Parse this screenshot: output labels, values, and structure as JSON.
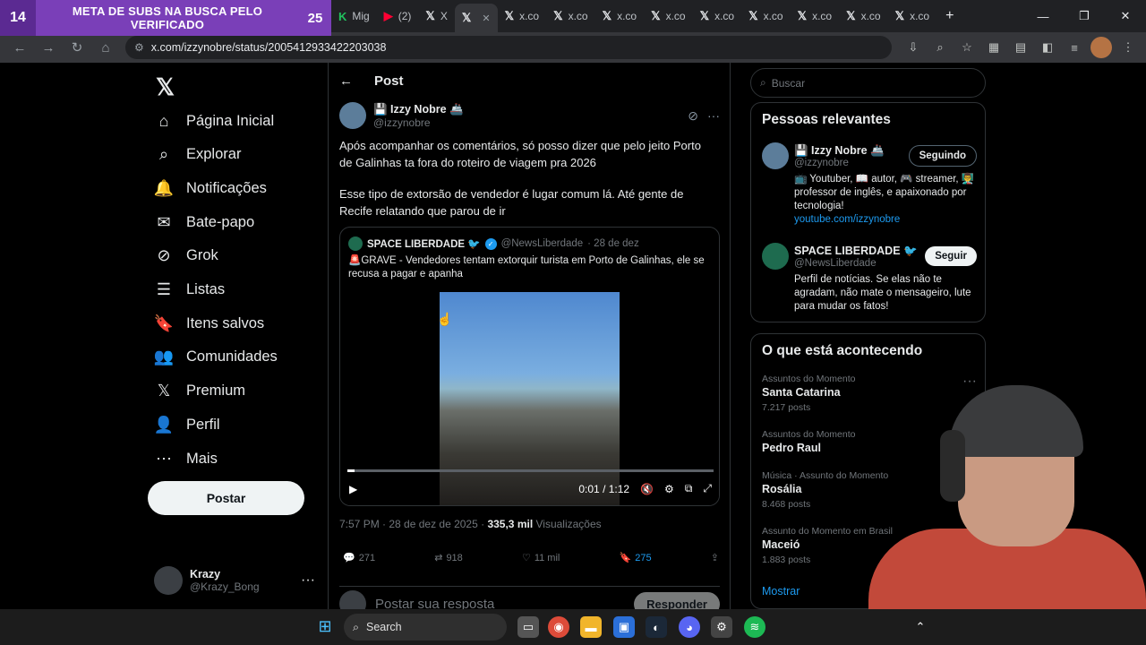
{
  "overlay": {
    "left_num": "14",
    "text": "META DE SUBS NA BUSCA PELO VERIFICADO",
    "right_num": "25"
  },
  "tabs": [
    {
      "icon": "K",
      "label": "Mig",
      "color": "#21c25e"
    },
    {
      "icon": "▶",
      "label": "(2)",
      "color": "#ff0033"
    },
    {
      "icon": "𝕏",
      "label": "X",
      "color": "#e8eaed"
    },
    {
      "icon": "𝕏",
      "label": "",
      "color": "#e8eaed",
      "active": true
    },
    {
      "icon": "𝕏",
      "label": "x.co",
      "color": "#e8eaed"
    },
    {
      "icon": "𝕏",
      "label": "x.co",
      "color": "#e8eaed"
    },
    {
      "icon": "𝕏",
      "label": "x.co",
      "color": "#e8eaed"
    },
    {
      "icon": "𝕏",
      "label": "x.co",
      "color": "#e8eaed"
    },
    {
      "icon": "𝕏",
      "label": "x.co",
      "color": "#e8eaed"
    },
    {
      "icon": "𝕏",
      "label": "x.co",
      "color": "#e8eaed"
    },
    {
      "icon": "𝕏",
      "label": "x.co",
      "color": "#e8eaed"
    },
    {
      "icon": "𝕏",
      "label": "x.co",
      "color": "#e8eaed"
    },
    {
      "icon": "𝕏",
      "label": "x.co",
      "color": "#e8eaed"
    }
  ],
  "browser": {
    "url": "x.com/izzynobre/status/2005412933422203038"
  },
  "nav": {
    "items": [
      {
        "label": "Página Inicial",
        "icon": "home-icon"
      },
      {
        "label": "Explorar",
        "icon": "search-icon"
      },
      {
        "label": "Notificações",
        "icon": "bell-icon"
      },
      {
        "label": "Bate-papo",
        "icon": "mail-icon"
      },
      {
        "label": "Grok",
        "icon": "grok-icon"
      },
      {
        "label": "Listas",
        "icon": "list-icon"
      },
      {
        "label": "Itens salvos",
        "icon": "bookmark-icon"
      },
      {
        "label": "Comunidades",
        "icon": "people-icon"
      },
      {
        "label": "Premium",
        "icon": "x-icon"
      },
      {
        "label": "Perfil",
        "icon": "person-icon"
      },
      {
        "label": "Mais",
        "icon": "more-icon"
      }
    ],
    "post_button": "Postar",
    "account": {
      "name": "Krazy",
      "handle": "@Krazy_Bong"
    }
  },
  "post": {
    "header": "Post",
    "author": {
      "name": "💾 Izzy Nobre 🚢",
      "handle": "@izzynobre"
    },
    "text1": "Após acompanhar os comentários, só posso dizer que pelo jeito Porto de Galinhas ta fora do roteiro de viagem pra 2026",
    "text2": "Esse tipo de extorsão de vendedor é lugar comum lá. Até gente de Recife relatando que parou de ir",
    "quote": {
      "name": "SPACE LIBERDADE 🐦",
      "handle": "@NewsLiberdade",
      "date": "· 28 de dez",
      "text": "🚨GRAVE - Vendedores tentam extorquir turista em Porto de Galinhas, ele se recusa a pagar e apanha",
      "video": {
        "time": "0:01 / 1:12",
        "progress": 0.02
      }
    },
    "meta": {
      "datetime": "7:57 PM · 28 de dez de 2025 ·",
      "views": "335,3 mil",
      "views_label": "Visualizações"
    },
    "stats": {
      "replies": "271",
      "reposts": "918",
      "likes": "11 mil",
      "bookmarks": "275"
    },
    "reply": {
      "placeholder": "Postar sua resposta",
      "button": "Responder"
    }
  },
  "sidebar": {
    "search_placeholder": "Buscar",
    "people_title": "Pessoas relevantes",
    "people": [
      {
        "name": "💾 Izzy Nobre 🚢",
        "handle": "@izzynobre",
        "button": "Seguindo",
        "bio": "📺 Youtuber, 📖 autor, 🎮 streamer, 👨‍🏫 professor de inglês, e apaixonado por tecnologia!",
        "link": "youtube.com/izzynobre"
      },
      {
        "name": "SPACE LIBERDADE 🐦",
        "handle": "@NewsLiberdade",
        "button": "Seguir",
        "bio": "Perfil de notícias. Se elas não te agradam, não mate o mensageiro, lute para mudar os fatos!",
        "link": ""
      }
    ],
    "trends_title": "O que está acontecendo",
    "trends": [
      {
        "context": "Assuntos do Momento",
        "name": "Santa Catarina",
        "count": "7.217 posts"
      },
      {
        "context": "Assuntos do Momento",
        "name": "Pedro Raul",
        "count": ""
      },
      {
        "context": "Música · Assunto do Momento",
        "name": "Rosália",
        "count": "8.468 posts"
      },
      {
        "context": "Assunto do Momento em Brasil",
        "name": "Maceió",
        "count": "1.883 posts"
      }
    ],
    "show_more": "Mostrar"
  },
  "taskbar": {
    "search": "Search"
  }
}
